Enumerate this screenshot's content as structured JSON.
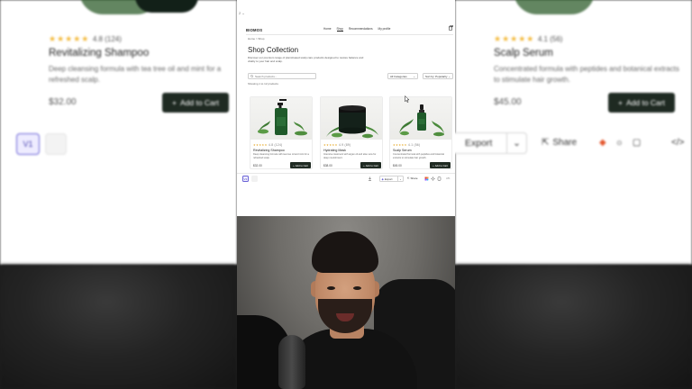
{
  "top_chrome": {
    "label": "2 ⌄"
  },
  "site": {
    "brand": "BIOMOS",
    "nav": [
      {
        "label": "Home"
      },
      {
        "label": "Shop"
      },
      {
        "label": "Recommendations"
      },
      {
        "label": "My profile"
      }
    ],
    "cart_count": "0"
  },
  "shop": {
    "breadcrumb": "Home > Shop",
    "title": "Shop Collection",
    "intro": "Discover our premium range of plant-based scalp care products designed to restore balance and vitality to your hair and scalp.",
    "search_placeholder": "Search products...",
    "category_select": "All Categories",
    "sort_select": "Sort by: Popularity",
    "result_count": "Showing 1 to 12 products"
  },
  "products": [
    {
      "stars": "★★★★★",
      "rating": "4.8 (124)",
      "title": "Revitalizing Shampoo",
      "desc": "Deep cleansing formula with tea tree oil and mint for a refreshed scalp.",
      "price": "$32.00",
      "cart_label": "Add to Cart"
    },
    {
      "stars": "★★★★★",
      "rating": "4.9 (89)",
      "title": "Hydrating Mask",
      "desc": "Intensive treatment with argan oil and aloe vera for deep nourishment.",
      "price": "$38.00",
      "cart_label": "Add to Cart"
    },
    {
      "stars": "★★★★★",
      "rating": "4.1 (56)",
      "title": "Scalp Serum",
      "desc": "Concentrated formula with peptides and botanical extracts to stimulate hair growth.",
      "price": "$45.00",
      "cart_label": "Add to Cart"
    }
  ],
  "editor": {
    "version": "V1",
    "export_label": "Export",
    "share_label": "Share",
    "code_label": "</>"
  },
  "zoom_left": {
    "stars": "★★★★★",
    "rating": "4.8 (124)",
    "title": "Revitalizing Shampoo",
    "desc": "Deep cleansing formula with tea tree oil and mint for a refreshed scalp.",
    "price": "$32.00",
    "cart_label": "Add to Cart",
    "version": "V1"
  },
  "zoom_right": {
    "stars": "★★★★★",
    "rating": "4.1 (56)",
    "title": "Scalp Serum",
    "desc": "Concentrated formula with peptides and botanical extracts to stimulate hair growth.",
    "price": "$45.00",
    "cart_label": "Add to Cart",
    "export_label": "Export",
    "share_label": "Share",
    "code_label": "</>"
  },
  "icons": {
    "search": "search-icon",
    "cart": "shopping-bag-icon",
    "cursor": "mouse-cursor-icon",
    "plus": "plus-icon",
    "share": "share-icon",
    "sun": "sun-icon",
    "figma": "figma-icon",
    "copy": "copy-icon",
    "code": "code-icon"
  },
  "colors": {
    "button_dark": "#1f2a22",
    "star": "#e6a825",
    "version_accent": "#6a63d6",
    "bottle_green": "#1f5a2a"
  }
}
